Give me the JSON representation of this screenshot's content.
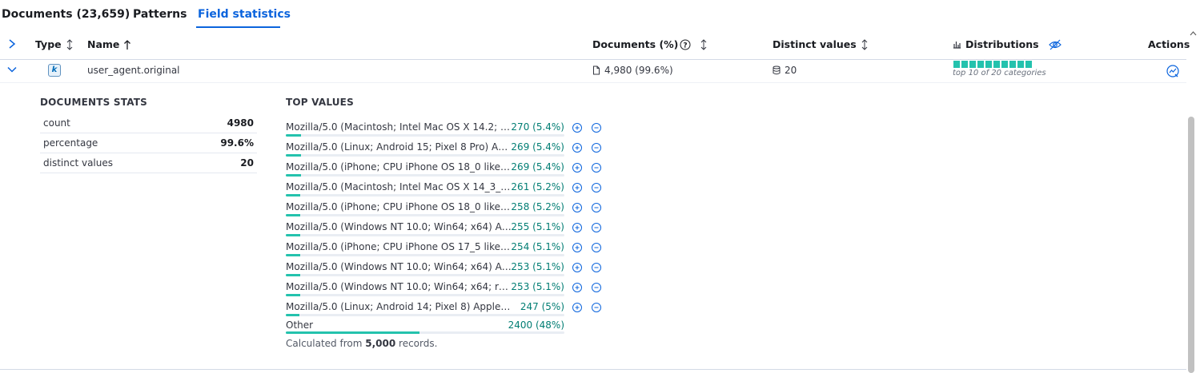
{
  "tabs": [
    {
      "label": "Documents (23,659)"
    },
    {
      "label": "Patterns"
    },
    {
      "label": "Field statistics"
    }
  ],
  "active_tab": "Field statistics",
  "table": {
    "headers": {
      "type": "Type",
      "name": "Name",
      "documents": "Documents (%)",
      "distinct": "Distinct values",
      "distributions": "Distributions",
      "actions": "Actions"
    },
    "row": {
      "type_badge": "k",
      "name": "user_agent.original",
      "documents": "4,980 (99.6%)",
      "distinct": "20",
      "distribution_caption": "top 10 of 20 categories",
      "distribution_segments": 10
    }
  },
  "doc_stats": {
    "title": "DOCUMENTS STATS",
    "rows": [
      {
        "label": "count",
        "value": "4980"
      },
      {
        "label": "percentage",
        "value": "99.6%"
      },
      {
        "label": "distinct values",
        "value": "20"
      }
    ]
  },
  "top_values": {
    "title": "TOP VALUES",
    "items": [
      {
        "label": "Mozilla/5.0 (Macintosh; Intel Mac OS X 14.2; rv:...",
        "value": "270 (5.4%)",
        "fraction": 0.054
      },
      {
        "label": "Mozilla/5.0 (Linux; Android 15; Pixel 8 Pro) Appl...",
        "value": "269 (5.4%)",
        "fraction": 0.054
      },
      {
        "label": "Mozilla/5.0 (iPhone; CPU iPhone OS 18_0 like ...",
        "value": "269 (5.4%)",
        "fraction": 0.054
      },
      {
        "label": "Mozilla/5.0 (Macintosh; Intel Mac OS X 14_3_1)...",
        "value": "261 (5.2%)",
        "fraction": 0.052
      },
      {
        "label": "Mozilla/5.0 (iPhone; CPU iPhone OS 18_0 like ...",
        "value": "258 (5.2%)",
        "fraction": 0.052
      },
      {
        "label": "Mozilla/5.0 (Windows NT 10.0; Win64; x64) Ap...",
        "value": "255 (5.1%)",
        "fraction": 0.051
      },
      {
        "label": "Mozilla/5.0 (iPhone; CPU iPhone OS 17_5 like ...",
        "value": "254 (5.1%)",
        "fraction": 0.051
      },
      {
        "label": "Mozilla/5.0 (Windows NT 10.0; Win64; x64) Ap...",
        "value": "253 (5.1%)",
        "fraction": 0.051
      },
      {
        "label": "Mozilla/5.0 (Windows NT 10.0; Win64; x64; rv:...",
        "value": "253 (5.1%)",
        "fraction": 0.051
      },
      {
        "label": "Mozilla/5.0 (Linux; Android 14; Pixel 8) AppleWeb...",
        "value": "247 (5%)",
        "fraction": 0.05
      }
    ],
    "other": {
      "label": "Other",
      "value": "2400 (48%)",
      "fraction": 0.48
    },
    "footnote_prefix": "Calculated from",
    "footnote_count": "5,000",
    "footnote_suffix": "records."
  },
  "colors": {
    "accent": "#0b64dd",
    "teal": "#24c2ad",
    "value_text": "#017d73"
  }
}
